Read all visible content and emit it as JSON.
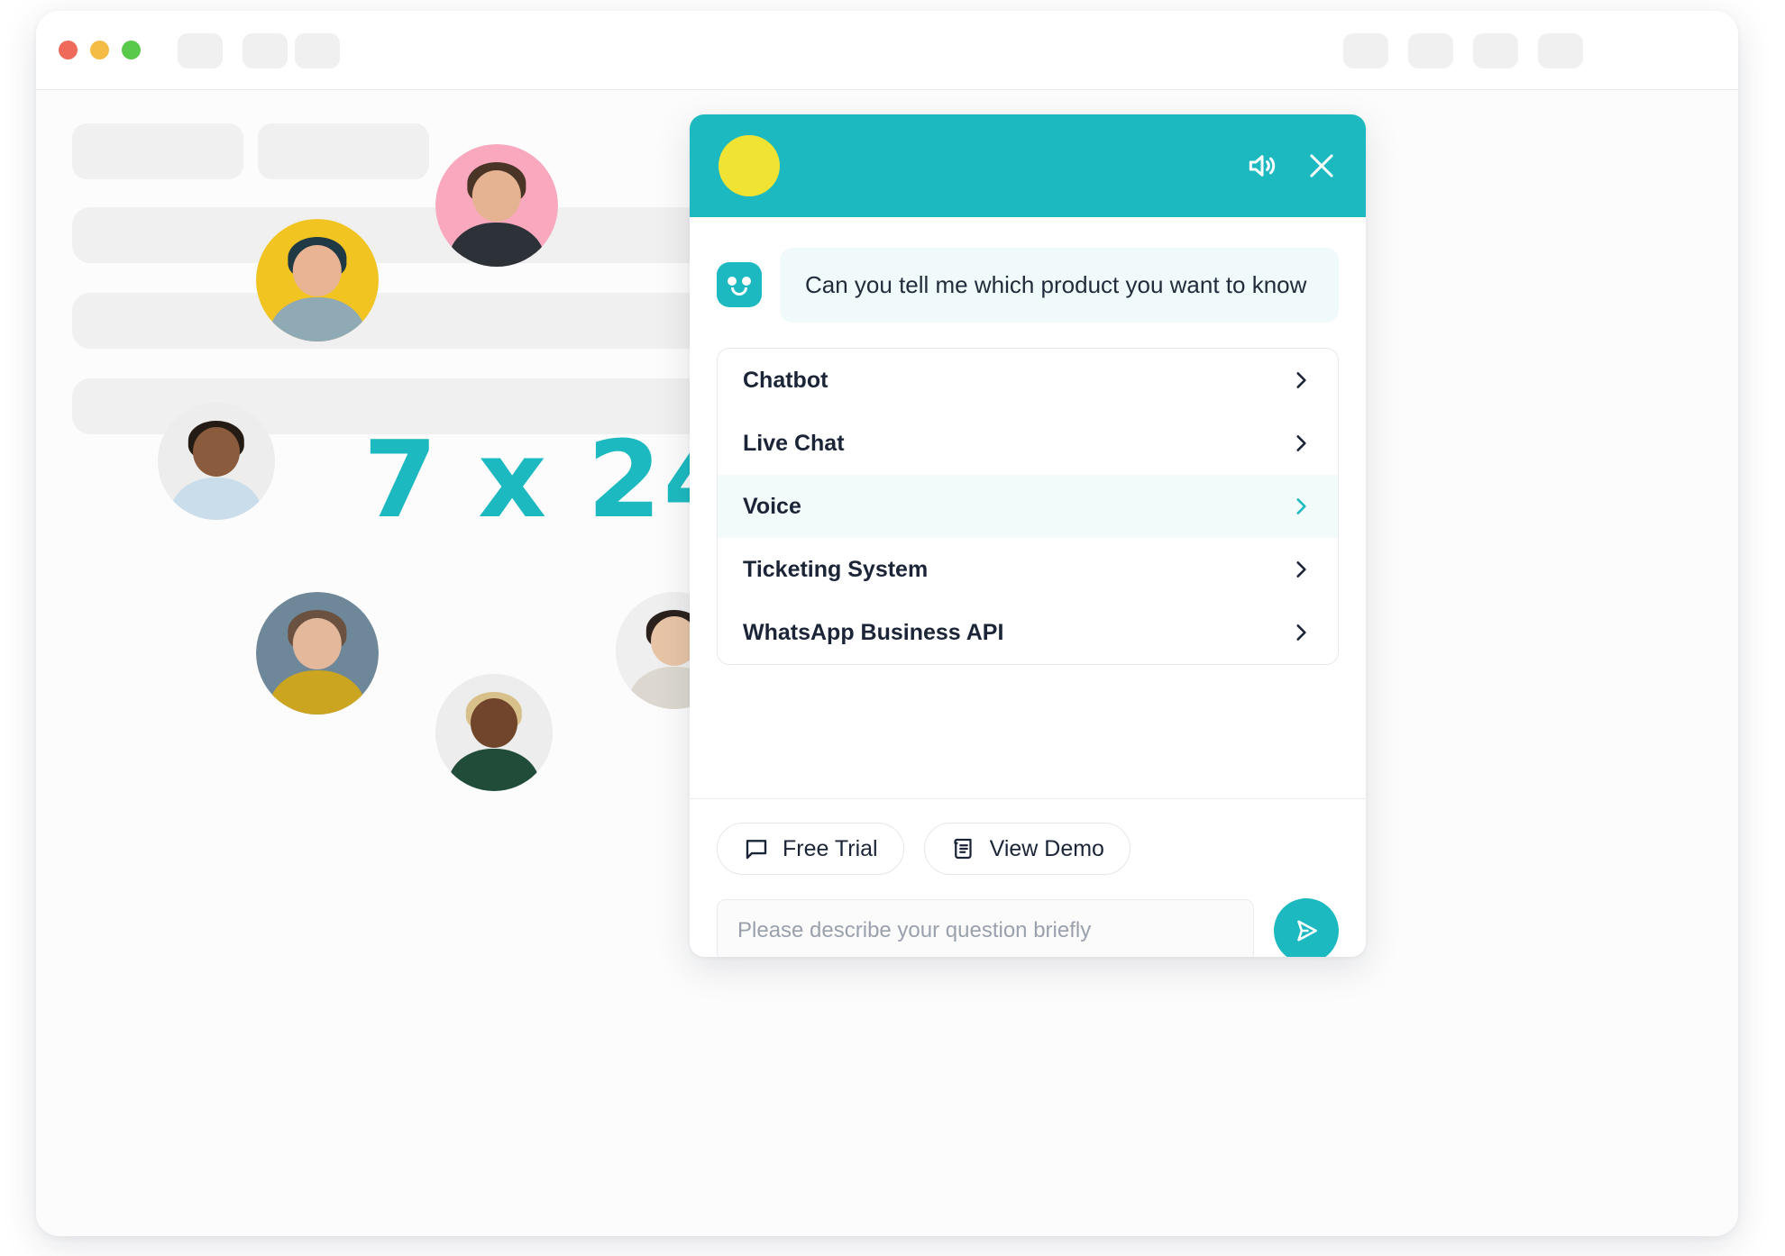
{
  "window": {
    "traffic_lights": [
      {
        "name": "close",
        "color": "#F06A5C"
      },
      {
        "name": "minimize",
        "color": "#F4BC45"
      },
      {
        "name": "maximize",
        "color": "#58C94A"
      }
    ]
  },
  "hero": {
    "availability_text": "7 x 24",
    "accent_color": "#1CBAC0",
    "badge_color": "#FCB713",
    "badge_icon": "clock-icon"
  },
  "avatars": [
    {
      "name": "avatar-bearded",
      "bg": "#F9A8BE",
      "skin": "#E5B391",
      "hair": "#4A3426",
      "shirt": "#2D3238"
    },
    {
      "name": "avatar-woman-yellow",
      "bg": "#F2C422",
      "skin": "#E8B493",
      "hair": "#1F3A44",
      "shirt": "#8FA9B5"
    },
    {
      "name": "avatar-man-glasses",
      "bg": "#EDEDED",
      "skin": "#8A5B3C",
      "hair": "#241B14",
      "shirt": "#CADDEB"
    },
    {
      "name": "avatar-woman-gray",
      "bg": "#6E8799",
      "skin": "#E3B89B",
      "hair": "#6B5140",
      "shirt": "#CBA51F"
    },
    {
      "name": "avatar-woman-short",
      "bg": "#EDEDED",
      "skin": "#70452C",
      "hair": "#D8C08A",
      "shirt": "#214C3A"
    },
    {
      "name": "avatar-woman-asian",
      "bg": "#EFEFEF",
      "skin": "#E8C4A6",
      "hair": "#2B211C",
      "shirt": "#DCD8CF"
    }
  ],
  "chat": {
    "header": {
      "brand_dot_color": "#F0E333",
      "background_color": "#1CBAC0",
      "sound_icon": "speaker-icon",
      "close_icon": "close-icon"
    },
    "message": {
      "bot_icon": "bot-face-icon",
      "text": "Can you tell me which product you want to know",
      "bubble_color": "#F1FAFA"
    },
    "options": [
      {
        "label": "Chatbot",
        "active": false,
        "chevron": "chevron-right-icon"
      },
      {
        "label": "Live Chat",
        "active": false,
        "chevron": "chevron-right-icon"
      },
      {
        "label": "Voice",
        "active": true,
        "chevron": "chevron-right-icon"
      },
      {
        "label": "Ticketing System",
        "active": false,
        "chevron": "chevron-right-icon"
      },
      {
        "label": "WhatsApp Business API",
        "active": false,
        "chevron": "chevron-right-icon"
      }
    ],
    "quick_actions": [
      {
        "label": "Free Trial",
        "icon": "chat-bubble-icon"
      },
      {
        "label": "View Demo",
        "icon": "scroll-document-icon"
      }
    ],
    "input": {
      "value": "",
      "placeholder": "Please describe your question briefly",
      "send_icon": "send-paper-plane-icon",
      "send_color": "#1CBAC0"
    },
    "utility_icons": [
      {
        "name": "mail-icon"
      },
      {
        "name": "emoji-smiley-icon"
      },
      {
        "name": "star-icon"
      }
    ]
  }
}
